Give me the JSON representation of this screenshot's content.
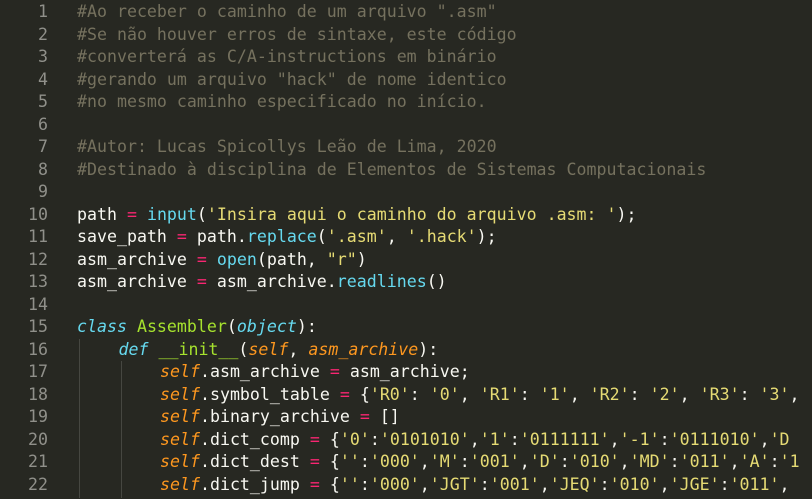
{
  "editor": {
    "lines": [
      {
        "num": "1",
        "tokens": [
          {
            "t": "#Ao receber o caminho de um arquivo \".asm\"",
            "c": "comment"
          }
        ]
      },
      {
        "num": "2",
        "tokens": [
          {
            "t": "#Se não houver erros de sintaxe, este código",
            "c": "comment"
          }
        ]
      },
      {
        "num": "3",
        "tokens": [
          {
            "t": "#converterá as C/A-instructions em binário",
            "c": "comment"
          }
        ]
      },
      {
        "num": "4",
        "tokens": [
          {
            "t": "#gerando um arquivo \"hack\" de nome identico",
            "c": "comment"
          }
        ]
      },
      {
        "num": "5",
        "tokens": [
          {
            "t": "#no mesmo caminho especificado no início.",
            "c": "comment"
          }
        ]
      },
      {
        "num": "6",
        "tokens": []
      },
      {
        "num": "7",
        "tokens": [
          {
            "t": "#Autor: Lucas Spicollys Leão de Lima, 2020",
            "c": "comment"
          }
        ]
      },
      {
        "num": "8",
        "tokens": [
          {
            "t": "#Destinado à disciplina de Elementos de Sistemas Computacionais",
            "c": "comment"
          }
        ]
      },
      {
        "num": "9",
        "tokens": []
      },
      {
        "num": "10",
        "tokens": [
          {
            "t": "path ",
            "c": "plain"
          },
          {
            "t": "=",
            "c": "op"
          },
          {
            "t": " ",
            "c": "plain"
          },
          {
            "t": "input",
            "c": "builtin"
          },
          {
            "t": "(",
            "c": "plain"
          },
          {
            "t": "'Insira aqui o caminho do arquivo .asm: '",
            "c": "string"
          },
          {
            "t": ");",
            "c": "plain"
          }
        ]
      },
      {
        "num": "11",
        "tokens": [
          {
            "t": "save_path ",
            "c": "plain"
          },
          {
            "t": "=",
            "c": "op"
          },
          {
            "t": " path.",
            "c": "plain"
          },
          {
            "t": "replace",
            "c": "builtin"
          },
          {
            "t": "(",
            "c": "plain"
          },
          {
            "t": "'.asm'",
            "c": "string"
          },
          {
            "t": ", ",
            "c": "plain"
          },
          {
            "t": "'.hack'",
            "c": "string"
          },
          {
            "t": ");",
            "c": "plain"
          }
        ]
      },
      {
        "num": "12",
        "tokens": [
          {
            "t": "asm_archive ",
            "c": "plain"
          },
          {
            "t": "=",
            "c": "op"
          },
          {
            "t": " ",
            "c": "plain"
          },
          {
            "t": "open",
            "c": "builtin"
          },
          {
            "t": "(path, ",
            "c": "plain"
          },
          {
            "t": "\"r\"",
            "c": "string"
          },
          {
            "t": ")",
            "c": "plain"
          }
        ]
      },
      {
        "num": "13",
        "tokens": [
          {
            "t": "asm_archive ",
            "c": "plain"
          },
          {
            "t": "=",
            "c": "op"
          },
          {
            "t": " asm_archive.",
            "c": "plain"
          },
          {
            "t": "readlines",
            "c": "builtin"
          },
          {
            "t": "()",
            "c": "plain"
          }
        ]
      },
      {
        "num": "14",
        "tokens": []
      },
      {
        "num": "15",
        "tokens": [
          {
            "t": "class",
            "c": "storage"
          },
          {
            "t": " ",
            "c": "plain"
          },
          {
            "t": "Assembler",
            "c": "classname"
          },
          {
            "t": "(",
            "c": "plain"
          },
          {
            "t": "object",
            "c": "storage"
          },
          {
            "t": "):",
            "c": "plain"
          }
        ]
      },
      {
        "num": "16",
        "indent": 1,
        "tokens": [
          {
            "t": "def",
            "c": "storage"
          },
          {
            "t": " ",
            "c": "plain"
          },
          {
            "t": "__init__",
            "c": "funcname"
          },
          {
            "t": "(",
            "c": "plain"
          },
          {
            "t": "self",
            "c": "param"
          },
          {
            "t": ", ",
            "c": "plain"
          },
          {
            "t": "asm_archive",
            "c": "param"
          },
          {
            "t": "):",
            "c": "plain"
          }
        ]
      },
      {
        "num": "17",
        "indent": 2,
        "tokens": [
          {
            "t": "self",
            "c": "self"
          },
          {
            "t": ".asm_archive ",
            "c": "plain"
          },
          {
            "t": "=",
            "c": "op"
          },
          {
            "t": " asm_archive;",
            "c": "plain"
          }
        ]
      },
      {
        "num": "18",
        "indent": 2,
        "tokens": [
          {
            "t": "self",
            "c": "self"
          },
          {
            "t": ".symbol_table ",
            "c": "plain"
          },
          {
            "t": "=",
            "c": "op"
          },
          {
            "t": " {",
            "c": "plain"
          },
          {
            "t": "'R0'",
            "c": "string"
          },
          {
            "t": ": ",
            "c": "plain"
          },
          {
            "t": "'0'",
            "c": "string"
          },
          {
            "t": ", ",
            "c": "plain"
          },
          {
            "t": "'R1'",
            "c": "string"
          },
          {
            "t": ": ",
            "c": "plain"
          },
          {
            "t": "'1'",
            "c": "string"
          },
          {
            "t": ", ",
            "c": "plain"
          },
          {
            "t": "'R2'",
            "c": "string"
          },
          {
            "t": ": ",
            "c": "plain"
          },
          {
            "t": "'2'",
            "c": "string"
          },
          {
            "t": ", ",
            "c": "plain"
          },
          {
            "t": "'R3'",
            "c": "string"
          },
          {
            "t": ": ",
            "c": "plain"
          },
          {
            "t": "'3'",
            "c": "string"
          },
          {
            "t": ",",
            "c": "plain"
          }
        ]
      },
      {
        "num": "19",
        "indent": 2,
        "tokens": [
          {
            "t": "self",
            "c": "self"
          },
          {
            "t": ".binary_archive ",
            "c": "plain"
          },
          {
            "t": "=",
            "c": "op"
          },
          {
            "t": " []",
            "c": "plain"
          }
        ]
      },
      {
        "num": "20",
        "indent": 2,
        "tokens": [
          {
            "t": "self",
            "c": "self"
          },
          {
            "t": ".dict_comp ",
            "c": "plain"
          },
          {
            "t": "=",
            "c": "op"
          },
          {
            "t": " {",
            "c": "plain"
          },
          {
            "t": "'0'",
            "c": "string"
          },
          {
            "t": ":",
            "c": "plain"
          },
          {
            "t": "'0101010'",
            "c": "string"
          },
          {
            "t": ",",
            "c": "plain"
          },
          {
            "t": "'1'",
            "c": "string"
          },
          {
            "t": ":",
            "c": "plain"
          },
          {
            "t": "'0111111'",
            "c": "string"
          },
          {
            "t": ",",
            "c": "plain"
          },
          {
            "t": "'-1'",
            "c": "string"
          },
          {
            "t": ":",
            "c": "plain"
          },
          {
            "t": "'0111010'",
            "c": "string"
          },
          {
            "t": ",",
            "c": "plain"
          },
          {
            "t": "'D",
            "c": "string"
          }
        ]
      },
      {
        "num": "21",
        "indent": 2,
        "tokens": [
          {
            "t": "self",
            "c": "self"
          },
          {
            "t": ".dict_dest ",
            "c": "plain"
          },
          {
            "t": "=",
            "c": "op"
          },
          {
            "t": " {",
            "c": "plain"
          },
          {
            "t": "''",
            "c": "string"
          },
          {
            "t": ":",
            "c": "plain"
          },
          {
            "t": "'000'",
            "c": "string"
          },
          {
            "t": ",",
            "c": "plain"
          },
          {
            "t": "'M'",
            "c": "string"
          },
          {
            "t": ":",
            "c": "plain"
          },
          {
            "t": "'001'",
            "c": "string"
          },
          {
            "t": ",",
            "c": "plain"
          },
          {
            "t": "'D'",
            "c": "string"
          },
          {
            "t": ":",
            "c": "plain"
          },
          {
            "t": "'010'",
            "c": "string"
          },
          {
            "t": ",",
            "c": "plain"
          },
          {
            "t": "'MD'",
            "c": "string"
          },
          {
            "t": ":",
            "c": "plain"
          },
          {
            "t": "'011'",
            "c": "string"
          },
          {
            "t": ",",
            "c": "plain"
          },
          {
            "t": "'A'",
            "c": "string"
          },
          {
            "t": ":",
            "c": "plain"
          },
          {
            "t": "'1",
            "c": "string"
          }
        ]
      },
      {
        "num": "22",
        "indent": 2,
        "tokens": [
          {
            "t": "self",
            "c": "self"
          },
          {
            "t": ".dict_jump ",
            "c": "plain"
          },
          {
            "t": "=",
            "c": "op"
          },
          {
            "t": " {",
            "c": "plain"
          },
          {
            "t": "''",
            "c": "string"
          },
          {
            "t": ":",
            "c": "plain"
          },
          {
            "t": "'000'",
            "c": "string"
          },
          {
            "t": ",",
            "c": "plain"
          },
          {
            "t": "'JGT'",
            "c": "string"
          },
          {
            "t": ":",
            "c": "plain"
          },
          {
            "t": "'001'",
            "c": "string"
          },
          {
            "t": ",",
            "c": "plain"
          },
          {
            "t": "'JEQ'",
            "c": "string"
          },
          {
            "t": ":",
            "c": "plain"
          },
          {
            "t": "'010'",
            "c": "string"
          },
          {
            "t": ",",
            "c": "plain"
          },
          {
            "t": "'JGE'",
            "c": "string"
          },
          {
            "t": ":",
            "c": "plain"
          },
          {
            "t": "'011'",
            "c": "string"
          },
          {
            "t": ",",
            "c": "plain"
          }
        ]
      }
    ]
  },
  "colors": {
    "background": "#272822",
    "comment": "#75715e",
    "plain": "#f8f8f2",
    "keyword_operator": "#f92672",
    "builtin_function": "#66d9ef",
    "string": "#e6db74",
    "class_name": "#a6e22e",
    "parameter": "#fd971f",
    "line_number": "#90908a"
  }
}
